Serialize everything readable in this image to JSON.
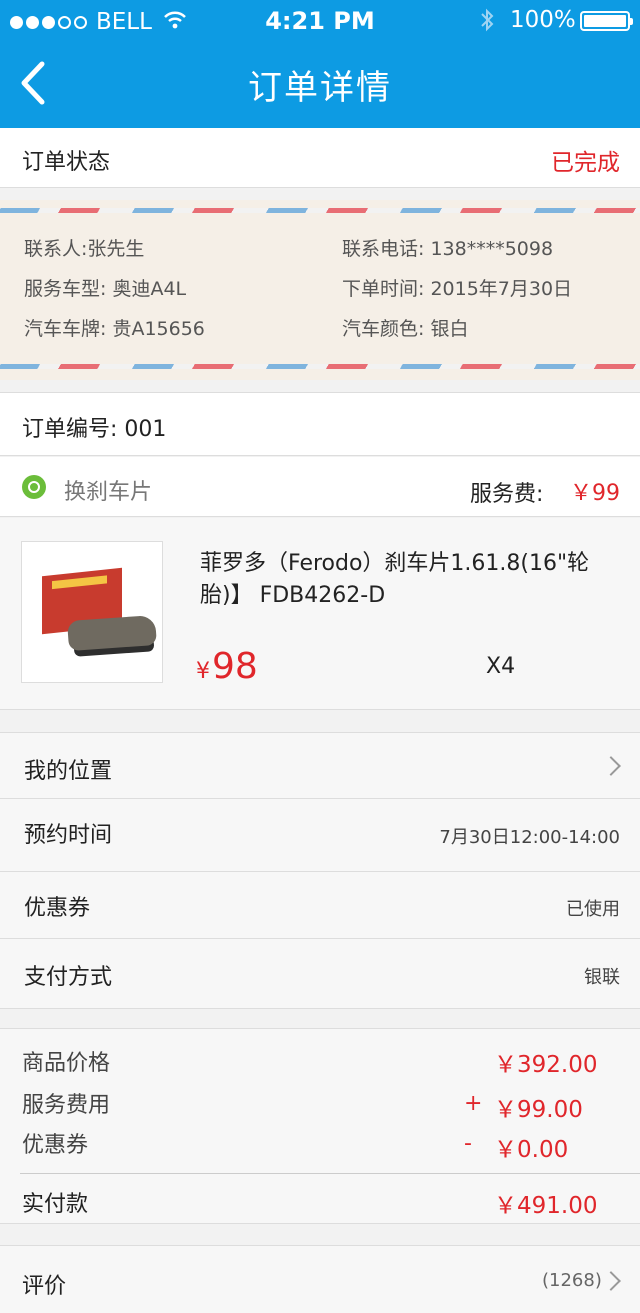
{
  "status_bar": {
    "carrier": "BELL",
    "time": "4:21 PM",
    "battery": "100%",
    "signal_bars_filled": 3,
    "signal_bars_total": 5
  },
  "nav": {
    "title": "订单详情"
  },
  "order_status": {
    "label": "订单状态",
    "value": "已完成"
  },
  "contact": {
    "name": "联系人:张先生",
    "phone": "联系电话:  138****5098",
    "car_model": "服务车型:  奥迪A4L",
    "order_time": "下单时间:  2015年7月30日",
    "plate": "汽车车牌:  贵A15656",
    "color": "汽车颜色:  银白"
  },
  "order_no": {
    "text": "订单编号:  001"
  },
  "service": {
    "icon": "brake-disc-icon",
    "name": "换刹车片",
    "fee_label": "服务费:",
    "fee_value": "￥99"
  },
  "product": {
    "name": "菲罗多（Ferodo）刹车片1.61.8(16\"轮胎)】 FDB4262-D",
    "currency": "¥",
    "price": "98",
    "qty": "X4"
  },
  "options": [
    {
      "label": "我的位置",
      "value": ""
    },
    {
      "label": "预约时间",
      "value": "7月30日12:00-14:00"
    },
    {
      "label": "优惠券",
      "value": "已使用"
    },
    {
      "label": "支付方式",
      "value": "银联"
    }
  ],
  "summary": {
    "goods_label": "商品价格",
    "goods_value": "￥392.00",
    "service_label": "服务费用",
    "service_sign": "+",
    "service_value": "￥99.00",
    "coupon_label": "优惠券",
    "coupon_sign": "-",
    "coupon_value": "￥0.00",
    "total_label": "实付款",
    "total_value": "￥491.00"
  },
  "review": {
    "label": "评价",
    "count": "(1268)"
  },
  "colors": {
    "primary": "#0d9be3",
    "accent_red": "#e0262b",
    "service_green": "#6bbd3a"
  }
}
